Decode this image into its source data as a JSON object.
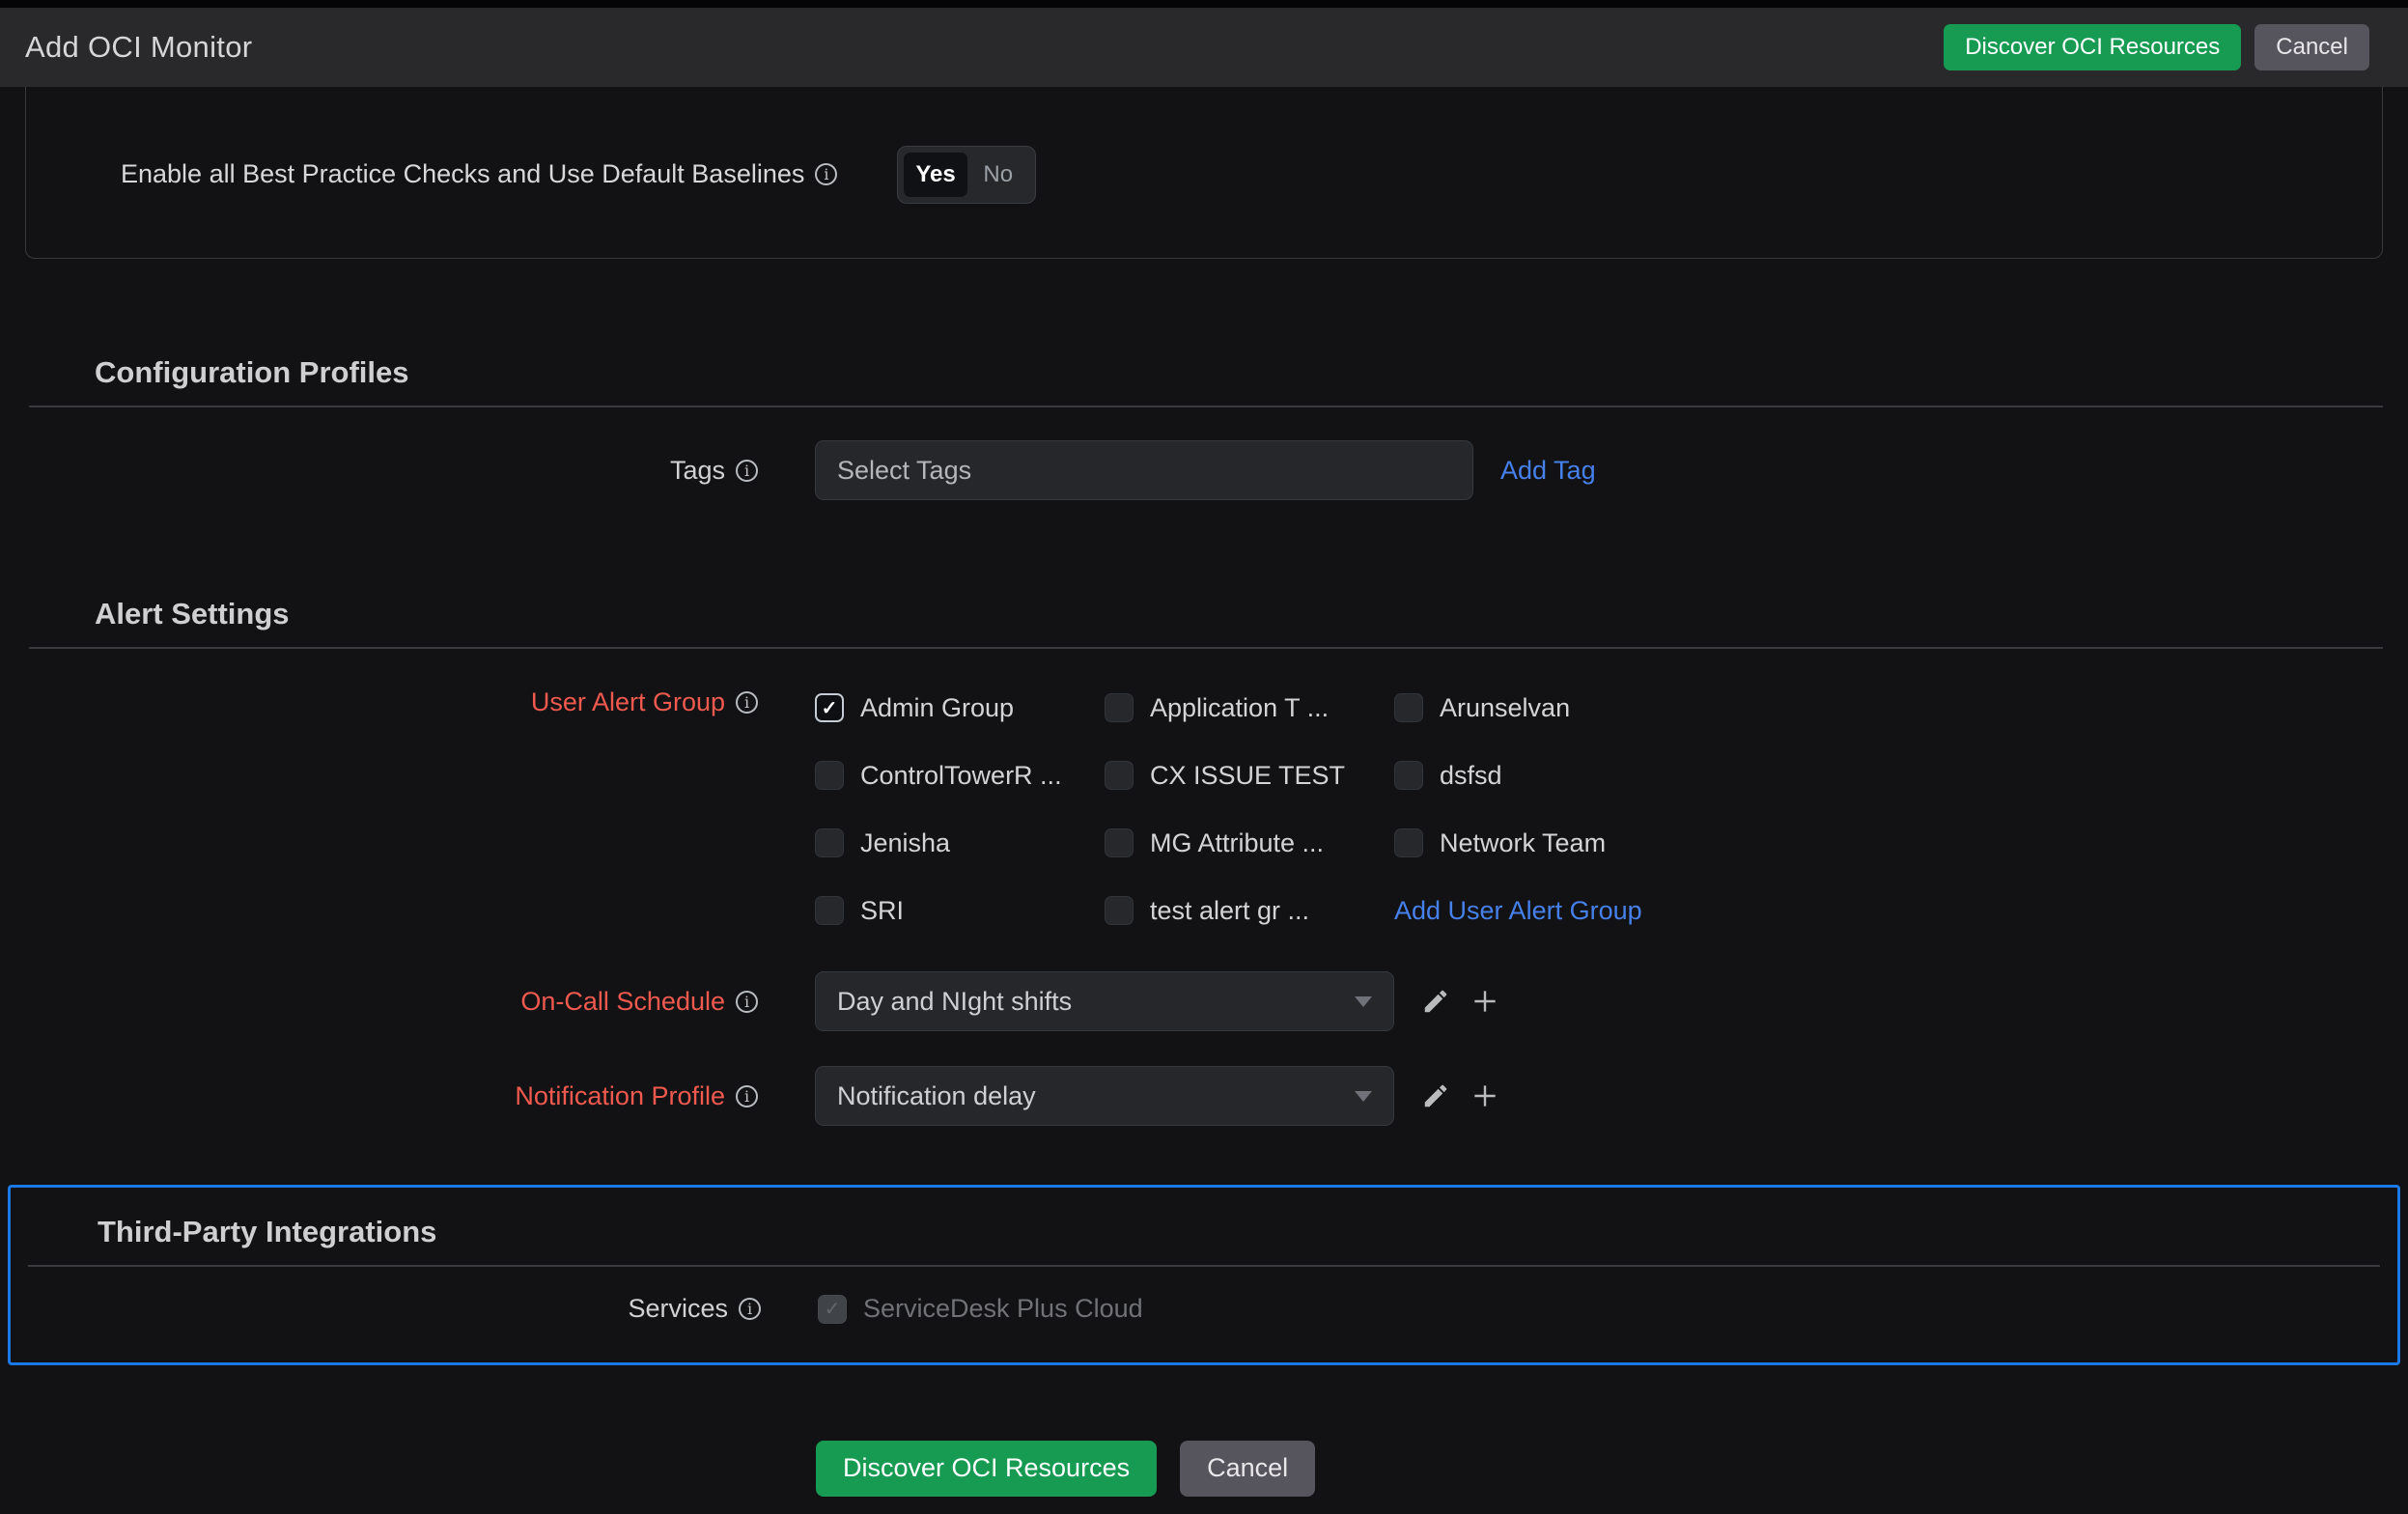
{
  "header": {
    "title": "Add OCI Monitor",
    "discover_button_label": "Discover OCI Resources",
    "cancel_button_label": "Cancel"
  },
  "best_practice": {
    "label": "Enable all Best Practice Checks and Use Default Baselines",
    "toggle": {
      "yes_label": "Yes",
      "no_label": "No",
      "selected": "Yes"
    }
  },
  "configuration_profiles": {
    "heading": "Configuration Profiles",
    "tags": {
      "label": "Tags",
      "placeholder": "Select Tags",
      "add_tag_link": "Add Tag"
    }
  },
  "alert_settings": {
    "heading": "Alert Settings",
    "user_alert_group": {
      "label": "User Alert Group",
      "add_link": "Add User Alert Group",
      "options": [
        {
          "label": "Admin Group",
          "checked": true
        },
        {
          "label": "Application T ...",
          "checked": false
        },
        {
          "label": "Arunselvan",
          "checked": false
        },
        {
          "label": "ControlTowerR ...",
          "checked": false
        },
        {
          "label": "CX ISSUE TEST",
          "checked": false
        },
        {
          "label": "dsfsd",
          "checked": false
        },
        {
          "label": "Jenisha",
          "checked": false
        },
        {
          "label": "MG Attribute ...",
          "checked": false
        },
        {
          "label": "Network Team",
          "checked": false
        },
        {
          "label": "SRI",
          "checked": false
        },
        {
          "label": "test alert gr ...",
          "checked": false
        }
      ]
    },
    "on_call_schedule": {
      "label": "On-Call Schedule",
      "selected_value": "Day and NIght shifts"
    },
    "notification_profile": {
      "label": "Notification Profile",
      "selected_value": "Notification delay"
    }
  },
  "third_party_integrations": {
    "heading": "Third-Party Integrations",
    "services": {
      "label": "Services",
      "option_label": "ServiceDesk Plus Cloud",
      "checked": true,
      "disabled": true
    }
  },
  "footer": {
    "discover_button_label": "Discover OCI Resources",
    "cancel_button_label": "Cancel"
  },
  "colors": {
    "accent_green": "#179b52",
    "link_blue": "#4680ea",
    "label_red": "#f0594e",
    "highlight_border_blue": "#1c78e4"
  }
}
